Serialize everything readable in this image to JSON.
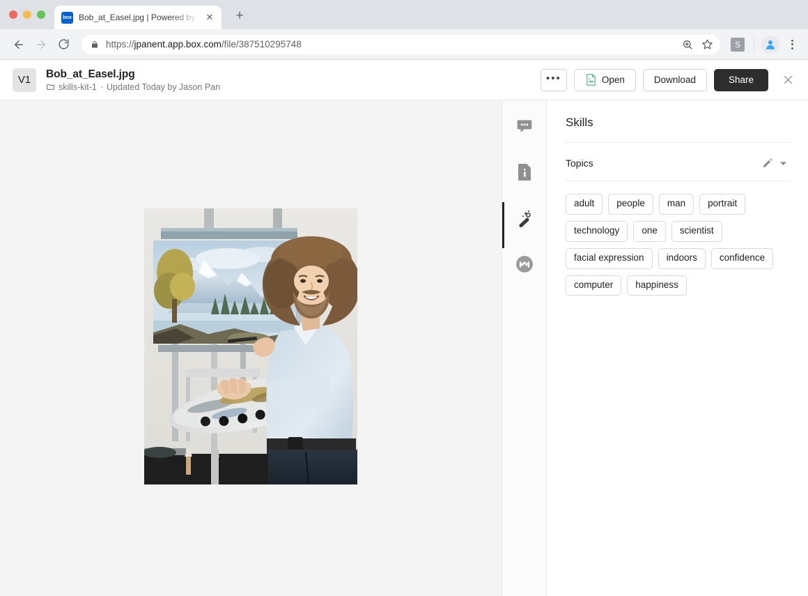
{
  "browser": {
    "tab": {
      "title": "Bob_at_Easel.jpg | Powered by",
      "favicon_text": "box"
    },
    "new_tab_label": "+",
    "close_tab_label": "✕",
    "url": {
      "scheme": "https://",
      "host": "jpanent.app.box.com",
      "path": "/file/387510295748"
    },
    "extension_badge": "S"
  },
  "header": {
    "version": "V1",
    "file_name": "Bob_at_Easel.jpg",
    "folder": "skills-kit-1",
    "separator": "·",
    "updated": "Updated Today by Jason Pan",
    "more_label": "•••",
    "open_label": "Open",
    "download_label": "Download",
    "share_label": "Share"
  },
  "rail": {
    "items": [
      {
        "name": "comments",
        "icon": "comment-icon",
        "active": false
      },
      {
        "name": "details",
        "icon": "file-info-icon",
        "active": false
      },
      {
        "name": "skills",
        "icon": "magic-wand-icon",
        "active": true
      },
      {
        "name": "metadata",
        "icon": "metadata-icon",
        "active": false
      }
    ]
  },
  "sidebar": {
    "title": "Skills",
    "section": {
      "label": "Topics",
      "edit_icon": "pencil-icon",
      "collapse_icon": "chevron-down-icon"
    },
    "tags": [
      "adult",
      "people",
      "man",
      "portrait",
      "technology",
      "one",
      "scientist",
      "facial expression",
      "indoors",
      "confidence",
      "computer",
      "happiness"
    ]
  },
  "colors": {
    "accent_dark": "#2d2d2d",
    "box_blue": "#0061d5",
    "open_green": "#5cb98f",
    "preview_bg": "#f4f4f4"
  }
}
